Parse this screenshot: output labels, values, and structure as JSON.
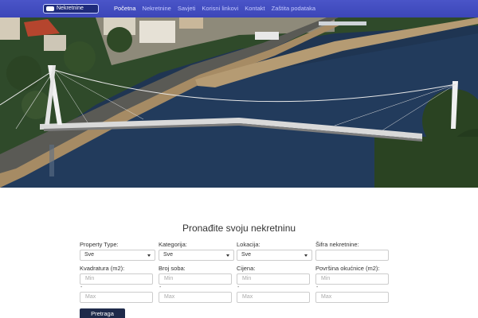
{
  "header": {
    "logo_text": "Nekretnine",
    "nav": [
      {
        "label": "Početna",
        "active": true
      },
      {
        "label": "Nekretnine",
        "active": false
      },
      {
        "label": "Savjeti",
        "active": false
      },
      {
        "label": "Korisni linkovi",
        "active": false
      },
      {
        "label": "Kontakt",
        "active": false
      },
      {
        "label": "Zaštita podataka",
        "active": false
      }
    ]
  },
  "search": {
    "title": "Pronađite svoju nekretninu",
    "property_type_label": "Property Type:",
    "property_type_value": "Sve",
    "category_label": "Kategorija:",
    "category_value": "Sve",
    "location_label": "Lokacija:",
    "location_value": "Sve",
    "code_label": "Šifra nekretnine:",
    "code_value": "",
    "area_label": "Kvadratura (m2):",
    "rooms_label": "Broj soba:",
    "price_label": "Cijena:",
    "yard_label": "Površina okućnice (m2):",
    "min_placeholder": "Min",
    "max_placeholder": "Max",
    "dash": "-",
    "submit_label": "Pretraga"
  },
  "colors": {
    "nav_bg": "#4049bf",
    "button_bg": "#1e2a4a"
  }
}
